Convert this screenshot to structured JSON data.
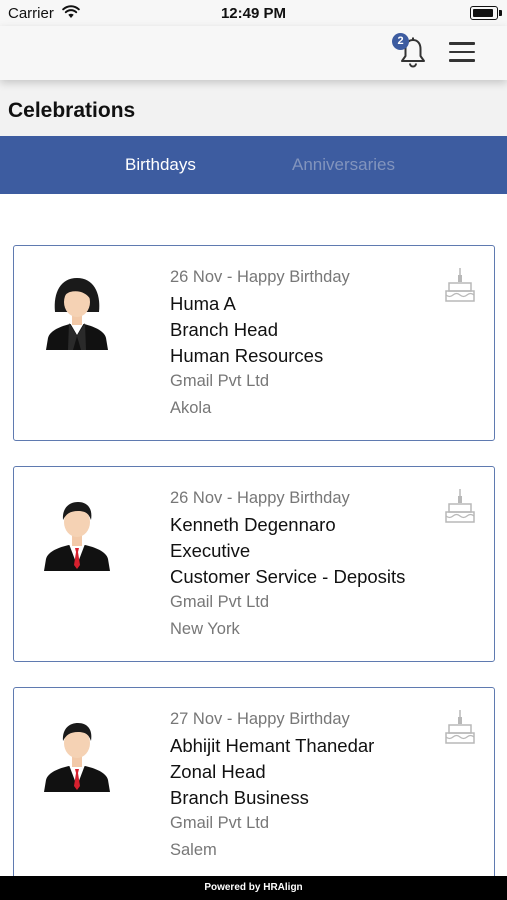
{
  "status_bar": {
    "carrier": "Carrier",
    "time": "12:49 PM"
  },
  "nav": {
    "notification_count": "2",
    "icons": [
      "bell-icon",
      "hamburger-menu-icon"
    ]
  },
  "page": {
    "title": "Celebrations"
  },
  "tabs": [
    {
      "label": "Birthdays",
      "active": true
    },
    {
      "label": "Anniversaries",
      "active": false
    }
  ],
  "accent_color": "#3d5ca0",
  "cards": [
    {
      "date_line": "26 Nov - Happy Birthday",
      "name": "Huma A",
      "designation": "Branch Head",
      "department": "Human Resources",
      "company": "Gmail Pvt Ltd",
      "location": "Akola",
      "avatar": "female-avatar-icon"
    },
    {
      "date_line": "26 Nov - Happy Birthday",
      "name": "Kenneth Degennaro",
      "designation": "Executive",
      "department": "Customer Service - Deposits",
      "company": "Gmail Pvt Ltd",
      "location": "New York",
      "avatar": "male-avatar-icon"
    },
    {
      "date_line": "27 Nov - Happy Birthday",
      "name": "Abhijit Hemant Thanedar",
      "designation": "Zonal Head",
      "department": "Branch Business",
      "company": "Gmail Pvt Ltd",
      "location": "Salem",
      "avatar": "male-avatar-icon"
    }
  ],
  "footer": {
    "text": "Powered by HRAlign"
  }
}
